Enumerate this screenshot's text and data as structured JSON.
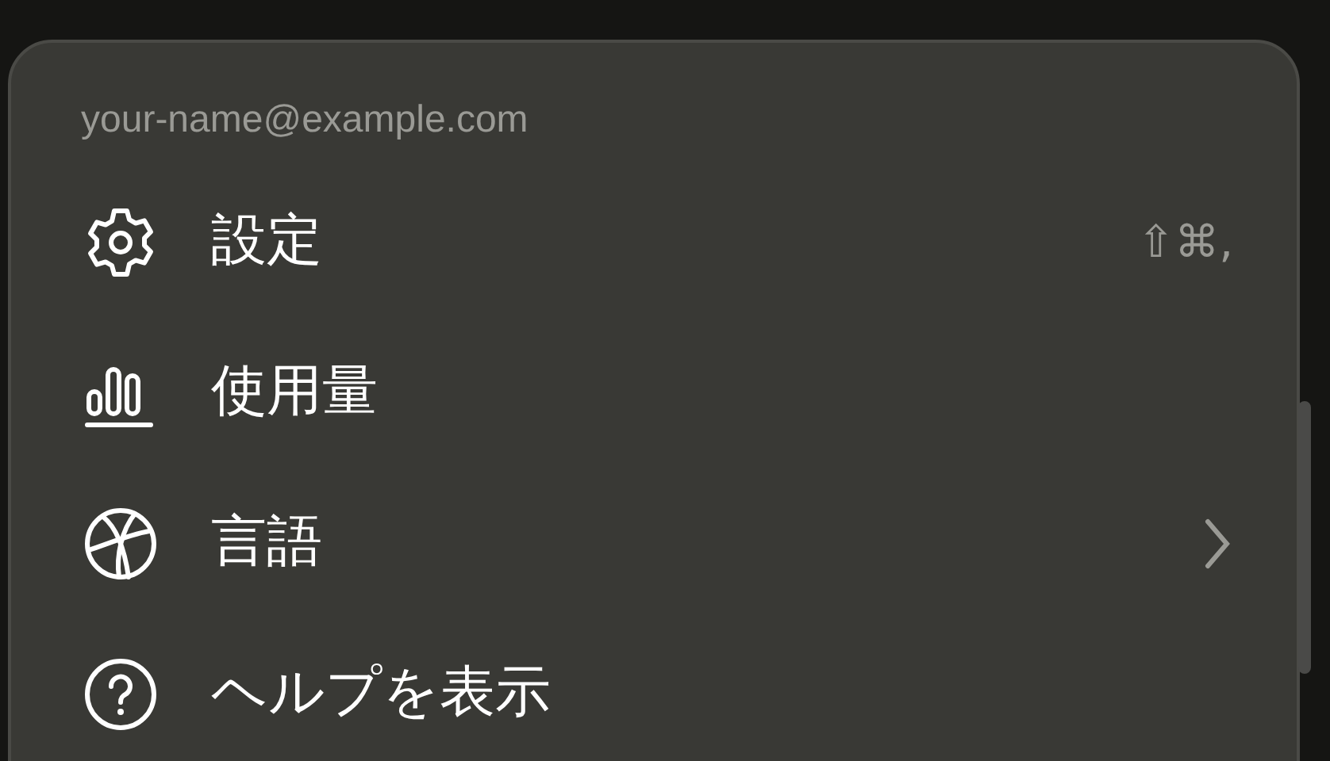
{
  "account": {
    "email": "your-name@example.com"
  },
  "menu_items": [
    {
      "label": "設定",
      "kind": "shortcut",
      "shortcut": "⇧⌘,"
    },
    {
      "label": "使用量",
      "kind": "plain"
    },
    {
      "label": "言語",
      "kind": "submenu"
    },
    {
      "label": "ヘルプを表示",
      "kind": "plain"
    }
  ]
}
